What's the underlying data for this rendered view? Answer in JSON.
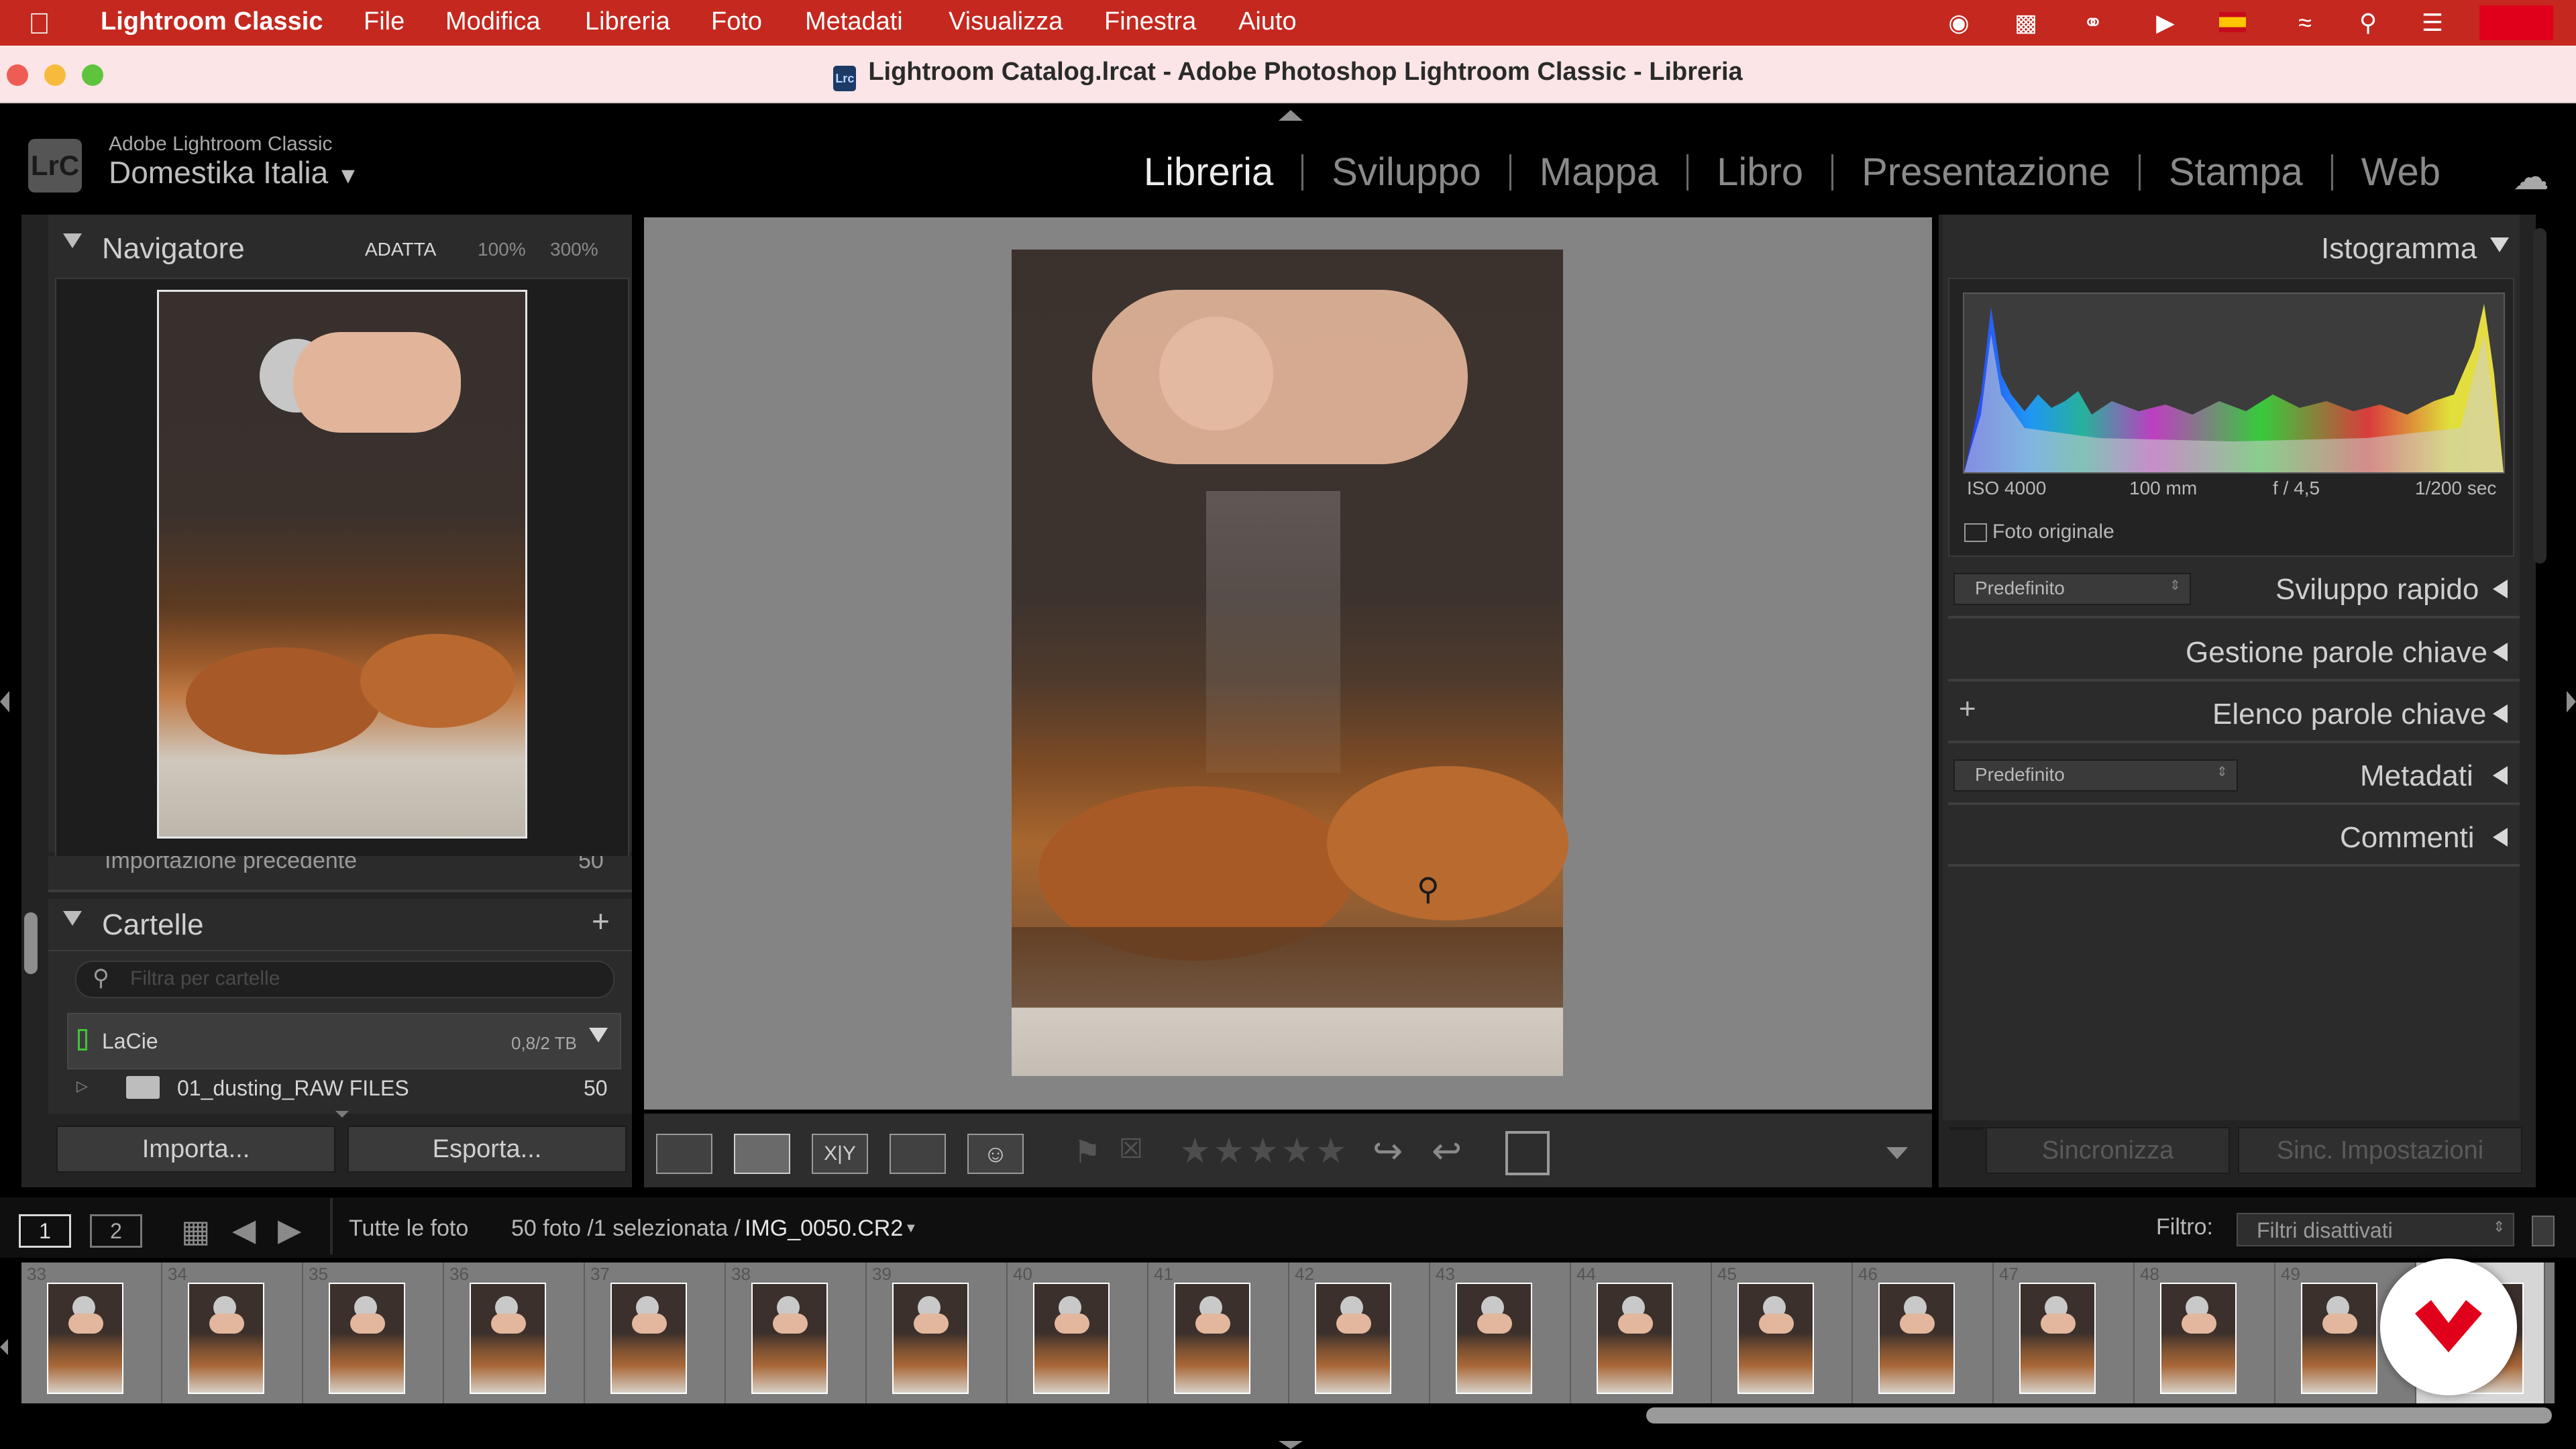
{
  "menubar": {
    "app_name": "Lightroom Classic",
    "items": [
      "File",
      "Modifica",
      "Libreria",
      "Foto",
      "Metadati",
      "Visualizza",
      "Finestra",
      "Aiuto"
    ]
  },
  "window": {
    "title": "Lightroom Catalog.lrcat - Adobe Photoshop Lightroom Classic - Libreria",
    "app_badge": "Lrc"
  },
  "identity": {
    "logo": "LrC",
    "line1": "Adobe Lightroom Classic",
    "line2": "Domestika Italia"
  },
  "modules": {
    "items": [
      "Libreria",
      "Sviluppo",
      "Mappa",
      "Libro",
      "Presentazione",
      "Stampa",
      "Web"
    ],
    "active": "Libreria"
  },
  "navigator": {
    "title": "Navigatore",
    "zoom_options": [
      "ADATTA",
      "100%",
      "300%"
    ],
    "hidden_row": "Importazione precedente",
    "hidden_count": "50"
  },
  "folders": {
    "title": "Cartelle",
    "add": "+",
    "search_placeholder": "Filtra per cartelle",
    "volume_name": "LaCie",
    "volume_size": "0,8/2 TB",
    "folder_name": "01_dusting_RAW FILES",
    "folder_count": "50"
  },
  "left_buttons": {
    "import": "Importa...",
    "export": "Esporta..."
  },
  "histogram": {
    "title": "Istogramma",
    "iso": "ISO 4000",
    "focal": "100 mm",
    "aperture": "f / 4,5",
    "shutter": "1/200 sec",
    "original_photo": "Foto originale"
  },
  "right_sections": {
    "preset1": "Predefinito",
    "quick_develop": "Sviluppo rapido",
    "keywording": "Gestione parole chiave",
    "keyword_list_add": "+",
    "keyword_list": "Elenco parole chiave",
    "preset2": "Predefinito",
    "metadata": "Metadati",
    "comments": "Commenti"
  },
  "right_buttons": {
    "sync": "Sincronizza",
    "sync_settings": "Sinc. Impostazioni"
  },
  "filmstrip_bar": {
    "view1": "1",
    "view2": "2",
    "source": "Tutte le foto",
    "info": "50 foto /1 selezionata /",
    "file": "IMG_0050.CR2",
    "filter_label": "Filtro:",
    "filter_value": "Filtri disattivati"
  },
  "filmstrip": {
    "numbers": [
      "33",
      "34",
      "35",
      "36",
      "37",
      "38",
      "39",
      "40",
      "41",
      "42",
      "43",
      "44",
      "45",
      "46",
      "47",
      "48",
      "49"
    ]
  },
  "colors": {
    "menubar": "#c4281f",
    "titlebar": "#fbe5e6",
    "panel": "#232323",
    "center": "#848484",
    "brand_badge": "#e0001b"
  },
  "icons": {
    "apple": "apple-icon",
    "cloud": "cloud-icon",
    "search": "search-icon",
    "loupe": "magnifier-icon",
    "wifi": "wifi-icon"
  }
}
